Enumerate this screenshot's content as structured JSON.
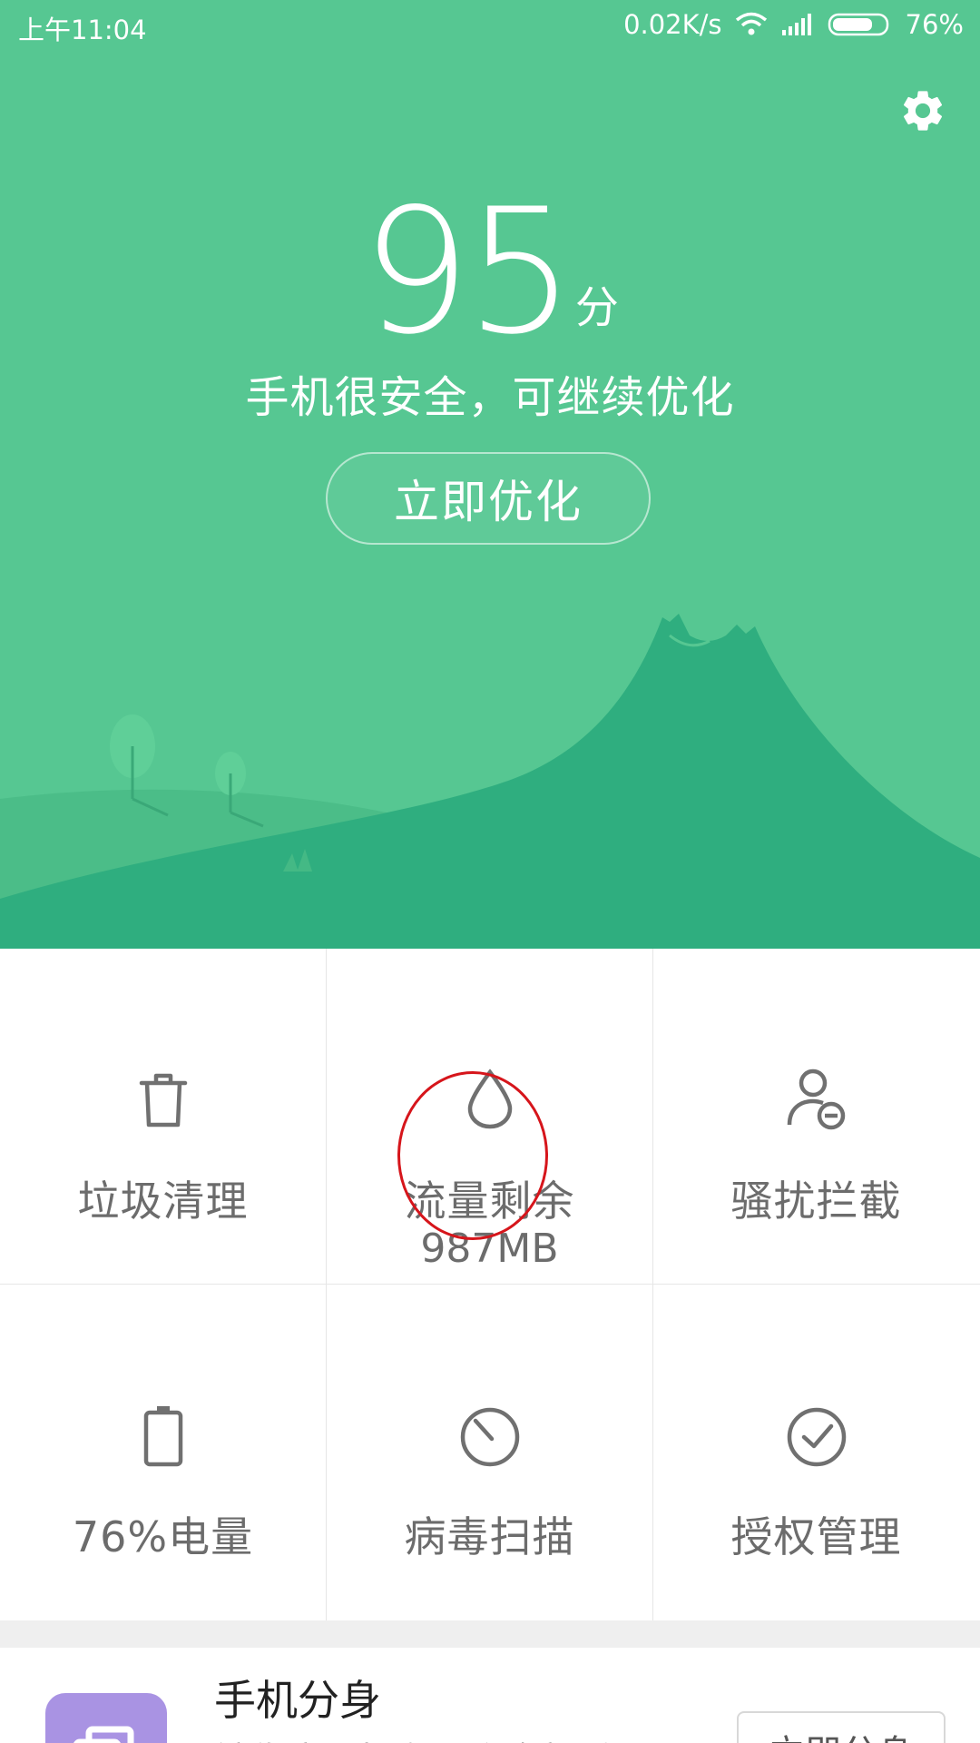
{
  "status_bar": {
    "time": "上午11:04",
    "network_speed": "0.02K/s",
    "battery_percent": "76%",
    "battery_level": 0.76,
    "icons": [
      "wifi-icon",
      "signal-icon",
      "battery-icon"
    ]
  },
  "hero": {
    "settings_icon": "gear-icon",
    "score": "95",
    "score_unit": "分",
    "subtitle": "手机很安全，可继续优化",
    "optimize_button": "立即优化",
    "colors": {
      "background": "#56c792",
      "mountain": "#2fae7f",
      "hill": "#4bbd88"
    }
  },
  "tools": [
    {
      "label": "垃圾清理",
      "icon": "trash-icon"
    },
    {
      "label": "流量剩余",
      "sub": "987MB",
      "icon": "droplet-icon"
    },
    {
      "label": "骚扰拦截",
      "icon": "user-block-icon"
    },
    {
      "label": "76%电量",
      "icon": "battery-icon"
    },
    {
      "label": "病毒扫描",
      "icon": "scan-icon"
    },
    {
      "label": "授权管理",
      "icon": "check-circle-icon"
    }
  ],
  "card": {
    "title": "手机分身",
    "desc": "镜像应用拥有一个全新系",
    "button": "立即分身",
    "icon": "clone-icon",
    "icon_color": "#a993e3"
  },
  "annotation": {
    "color": "#d6151b"
  }
}
